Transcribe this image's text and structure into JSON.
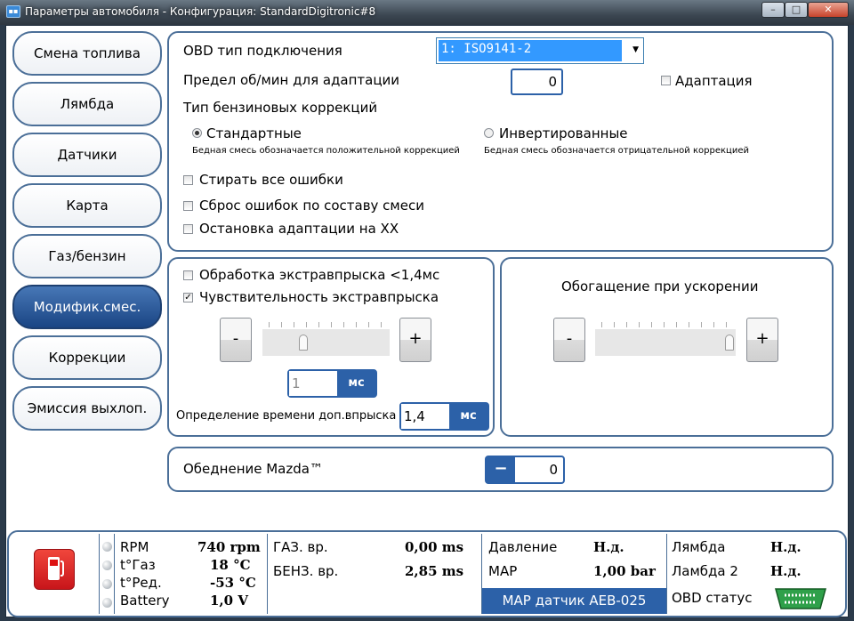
{
  "window": {
    "title": "Параметры автомобиля - Конфигурация: StandardDigitronic#8",
    "minimize": "–",
    "maximize": "□",
    "close": "✕"
  },
  "nav": [
    "Смена топлива",
    "Лямбда",
    "Датчики",
    "Карта",
    "Газ/бензин",
    "Модифик.смес.",
    "Коррекции",
    "Эмиссия выхлоп."
  ],
  "nav_active": 5,
  "top": {
    "obd_label": "OBD тип подключения",
    "obd_value": "1: ISO9141-2",
    "rpm_label": "Предел об/мин для адаптации",
    "rpm_value": "0",
    "adapt_label": "Адаптация",
    "corr_label": "Тип бензиновых коррекций",
    "std_label": "Стандартные",
    "std_hint": "Бедная смесь обозначается положительной коррекцией",
    "inv_label": "Инвертированные",
    "inv_hint": "Бедная смесь обозначается отрицательной коррекцией",
    "cb1": "Стирать все ошибки",
    "cb2": "Сброс ошибок по составу смеси",
    "cb3": "Остановка адаптации на XX"
  },
  "extra": {
    "cb1": "Обработка экстравпрыска <1,4мс",
    "cb2": "Чувствительность экстравпрыска",
    "minus": "-",
    "plus": "+",
    "slider_fraction": 0.3,
    "value": "1",
    "unit": "мс",
    "det_label": "Определение времени доп.впрыска",
    "det_value": "1,4",
    "det_unit": "мс"
  },
  "accel": {
    "title": "Обогащение при ускорении",
    "minus": "-",
    "plus": "+",
    "slider_fraction": 1.0
  },
  "mazda": {
    "label": "Обеднение Mazda™",
    "minus": "−",
    "value": "0"
  },
  "status": {
    "rpm_l": "RPM",
    "rpm_v": "740 rpm",
    "tgas_l": "t°Газ",
    "tgas_v": "18 °C",
    "tred_l": "t°Ред.",
    "tred_v": "-53 °C",
    "bat_l": "Battery",
    "bat_v": "1,0 V",
    "gas_l": "ГАЗ. вр.",
    "gas_v": "0,00 ms",
    "benz_l": "БЕНЗ. вр.",
    "benz_v": "2,85 ms",
    "press_l": "Давление",
    "press_v": "Н.д.",
    "map_l": "MAP",
    "map_v": "1,00 bar",
    "map_sensor": "MAP датчик AEB-025",
    "lam_l": "Лямбда",
    "lam_v": "Н.д.",
    "lam2_l": "Ламбда 2",
    "lam2_v": "Н.д.",
    "obd_l": "OBD статус"
  }
}
